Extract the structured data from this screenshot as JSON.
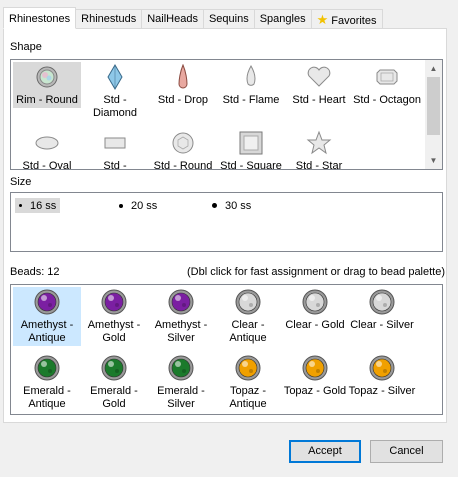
{
  "tabs": [
    "Rhinestones",
    "Rhinestuds",
    "NailHeads",
    "Sequins",
    "Spangles",
    "Favorites"
  ],
  "shape": {
    "label": "Shape",
    "items": [
      {
        "label": "Rim - Round",
        "icon": "rim-round-icon"
      },
      {
        "label": "Std - Diamond",
        "icon": "diamond-icon"
      },
      {
        "label": "Std - Drop",
        "icon": "drop-icon"
      },
      {
        "label": "Std - Flame",
        "icon": "flame-icon"
      },
      {
        "label": "Std - Heart",
        "icon": "heart-icon"
      },
      {
        "label": "Std - Octagon",
        "icon": "octagon-icon"
      },
      {
        "label": "Std - Oval",
        "icon": "oval-icon"
      },
      {
        "label": "Std -",
        "icon": "rectangle-icon"
      },
      {
        "label": "Std - Round",
        "icon": "round-icon"
      },
      {
        "label": "Std - Square",
        "icon": "square-icon"
      },
      {
        "label": "Std - Star",
        "icon": "star-icon"
      }
    ]
  },
  "size": {
    "label": "Size",
    "items": [
      "16 ss",
      "20 ss",
      "30 ss"
    ]
  },
  "beads": {
    "label": "Beads: 12",
    "hint": "(Dbl click for fast assignment or drag to bead palette)",
    "items": [
      {
        "label": "Amethyst - Antique",
        "color": "#7b1fa2"
      },
      {
        "label": "Amethyst - Gold",
        "color": "#7b1fa2"
      },
      {
        "label": "Amethyst - Silver",
        "color": "#7b1fa2"
      },
      {
        "label": "Clear - Antique",
        "color": "#d8d8d8"
      },
      {
        "label": "Clear - Gold",
        "color": "#d8d8d8"
      },
      {
        "label": "Clear - Silver",
        "color": "#d8d8d8"
      },
      {
        "label": "Emerald - Antique",
        "color": "#1b7a2b"
      },
      {
        "label": "Emerald - Gold",
        "color": "#1b7a2b"
      },
      {
        "label": "Emerald - Silver",
        "color": "#1b7a2b"
      },
      {
        "label": "Topaz - Antique",
        "color": "#f0a000"
      },
      {
        "label": "Topaz - Gold",
        "color": "#f0a000"
      },
      {
        "label": "Topaz - Silver",
        "color": "#f0a000"
      }
    ]
  },
  "buttons": {
    "accept": "Accept",
    "cancel": "Cancel"
  }
}
